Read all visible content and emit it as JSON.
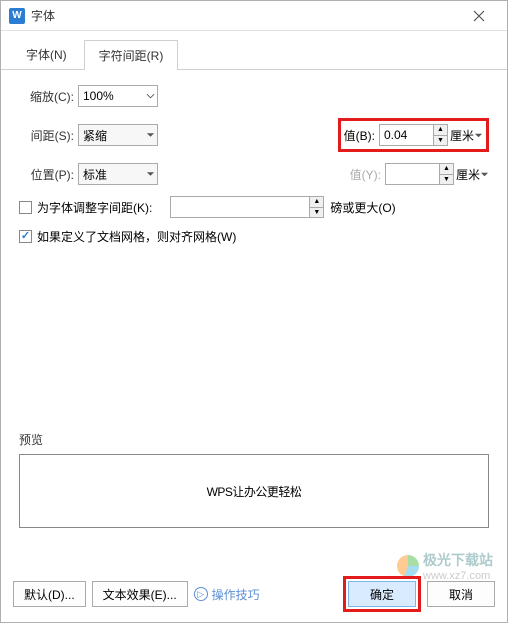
{
  "window": {
    "icon": "W",
    "title": "字体"
  },
  "tabs": {
    "font": "字体(N)",
    "spacing": "字符间距(R)",
    "active": 1
  },
  "fields": {
    "scale": {
      "label": "缩放(C):",
      "value": "100%"
    },
    "spacing": {
      "label": "间距(S):",
      "value": "紧缩"
    },
    "position": {
      "label": "位置(P):",
      "value": "标准"
    },
    "valueB": {
      "label": "值(B):",
      "value": "0.04",
      "unit": "厘米"
    },
    "valueY": {
      "label": "值(Y):",
      "value": "",
      "unit": "厘米"
    },
    "kerning": {
      "label": "为字体调整字间距(K):",
      "checked": false,
      "value": "",
      "unit": "磅或更大(O)"
    },
    "snapGrid": {
      "label": "如果定义了文档网格，则对齐网格(W)",
      "checked": true
    }
  },
  "preview": {
    "label": "预览",
    "text": "WPS让办公更轻松"
  },
  "footer": {
    "default": "默认(D)...",
    "textEffect": "文本效果(E)...",
    "hint": "操作技巧",
    "ok": "确定",
    "cancel": "取消"
  },
  "watermark": {
    "name": "极光下载站",
    "url": "www.xz7.com"
  }
}
